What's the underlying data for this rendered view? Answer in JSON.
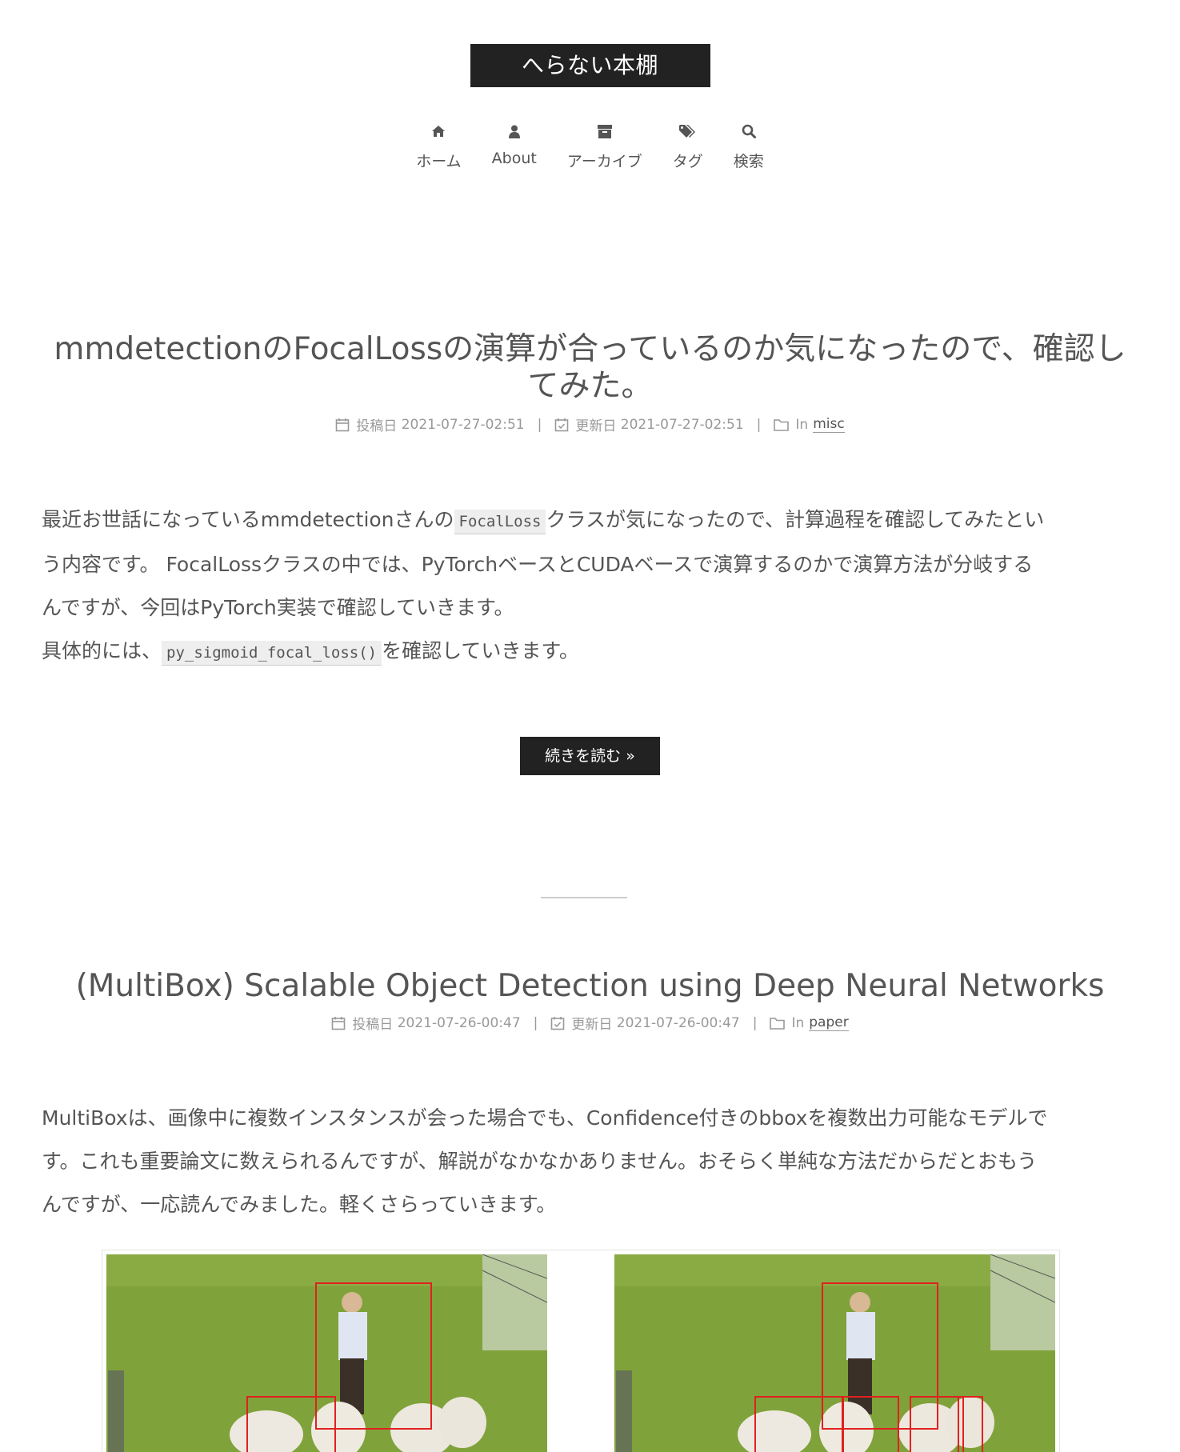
{
  "site": {
    "title": "へらない本棚"
  },
  "menu": [
    {
      "label": "ホーム",
      "icon": "home-icon"
    },
    {
      "label": "About",
      "icon": "user-icon"
    },
    {
      "label": "アーカイブ",
      "icon": "archive-icon"
    },
    {
      "label": "タグ",
      "icon": "tags-icon"
    },
    {
      "label": "検索",
      "icon": "search-icon"
    }
  ],
  "posts": [
    {
      "title_line1": "mmdetectionのFocalLossの演算が合っているのか気になったので、確認し",
      "title_line2": "てみた。",
      "posted_label": "投稿日",
      "posted": "2021-07-27-02:51",
      "updated_label": "更新日",
      "updated": "2021-07-27-02:51",
      "in_label": "In",
      "category": "misc",
      "body": {
        "p1_a": "最近お世話になっているmmdetectionさんの",
        "p1_code": "FocalLoss",
        "p1_b": "クラスが気になったので、計算過程を確認してみたとい",
        "p1_c": "う内容です。 FocalLossクラスの中では、PyTorchベースとCUDAベースで演算するのかで演算方法が分岐する",
        "p1_d": "んですが、今回はPyTorch実装で確認していきます。",
        "p2_a": "具体的には、",
        "p2_code": "py_sigmoid_focal_loss()",
        "p2_b": "を確認していきます。"
      },
      "readmore": "続きを読む »"
    },
    {
      "title_line1": "(MultiBox) Scalable Object Detection using Deep Neural Networks",
      "posted_label": "投稿日",
      "posted": "2021-07-26-00:47",
      "updated_label": "更新日",
      "updated": "2021-07-26-00:47",
      "in_label": "In",
      "category": "paper",
      "body": {
        "l1": "MultiBoxは、画像中に複数インスタンスが会った場合でも、Confidence付きのbboxを複数出力可能なモデルで",
        "l2": "す。これも重要論文に数えられるんですが、解説がなかなかありません。おそらく単純な方法だからだとおもう",
        "l3": "んですが、一応読んでみました。軽くさらっていきます。"
      }
    }
  ],
  "colors": {
    "brand_bg": "#222222",
    "text": "#555555",
    "meta": "#999999",
    "grass": "#7fa23a",
    "bbox": "#e02020"
  }
}
